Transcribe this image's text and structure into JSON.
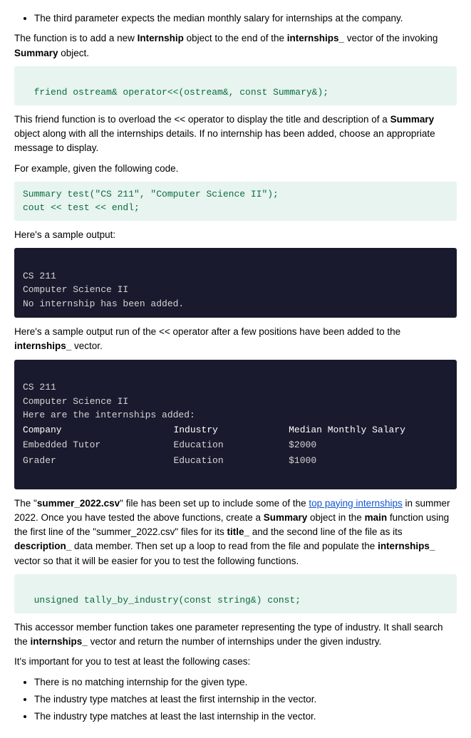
{
  "content": {
    "bullet1": "The third parameter expects the median monthly salary for internships at the company.",
    "para1": "The function is to add a new ",
    "para1_bold1": "Internship",
    "para1_mid": " object to the end of the ",
    "para1_bold2": "internships_",
    "para1_end": " vector of the invoking ",
    "para1_bold3": "Summary",
    "para1_end2": " object.",
    "code1": "friend ostream& operator<<(ostream&, const Summary&);",
    "para2_start": "This friend function is to overload the << operator to display the title and description of a ",
    "para2_bold1": "Summary",
    "para2_mid": " object along with all the internships details. If no internship has been added, choose an appropriate message to display.",
    "para3": "For example, given the following code.",
    "code2_line1": "Summary test(\"CS 211\", \"Computer Science II\");",
    "code2_line2": "cout << test << endl;",
    "para4": "Here's a sample output:",
    "dark_box1_line1": "CS 211",
    "dark_box1_line2": "Computer Science II",
    "dark_box1_line3": "No internship has been added.",
    "para5_start": "Here's a sample output run of the << operator after a few positions have been added to the ",
    "para5_bold": "internships_",
    "para5_end": " vector.",
    "dark_box2_line1": "CS 211",
    "dark_box2_line2": "Computer Science II",
    "dark_box2_line3": "Here are the internships added:",
    "dark_box2_header": "Company                    Industry          Median Monthly Salary",
    "dark_box2_row1_col1": "Embedded Tutor",
    "dark_box2_row1_col2": "Education",
    "dark_box2_row1_col3": "$2000",
    "dark_box2_row2_col1": "Grader",
    "dark_box2_row2_col2": "Education",
    "dark_box2_row2_col3": "$1000",
    "para6_start": "The \"",
    "para6_bold1": "summer_2022.csv",
    "para6_mid1": "\" file has been set up to include some of the ",
    "para6_link": "top paying internships",
    "para6_mid2": " in summer 2022. Once you have tested the above functions, create a ",
    "para6_bold2": "Summary",
    "para6_mid3": " object in the ",
    "para6_bold3": "main",
    "para6_mid4": " function using the first line of the \"summer_2022.csv\" files for its ",
    "para6_bold4": "title_",
    "para6_mid5": " and the second line of the file as its ",
    "para6_bold5": "description_",
    "para6_end": " data member. Then set up a loop to read from the file and populate the ",
    "para6_bold6": "internships_",
    "para6_end2": " vector so that it will be easier for you to test the following functions.",
    "code3": "unsigned tally_by_industry(const string&) const;",
    "para7_start": "This accessor member function takes one parameter representing the type of industry. It shall search the ",
    "para7_bold": "internships_",
    "para7_end": " vector and return the number of internships under the given industry.",
    "para8": "It's important for you to test at least the following cases:",
    "bullet2": "There is no matching internship for the given type.",
    "bullet3": "The industry type matches at least the first internship in the vector.",
    "bullet4": "The industry type matches at least the last internship in the vector."
  }
}
